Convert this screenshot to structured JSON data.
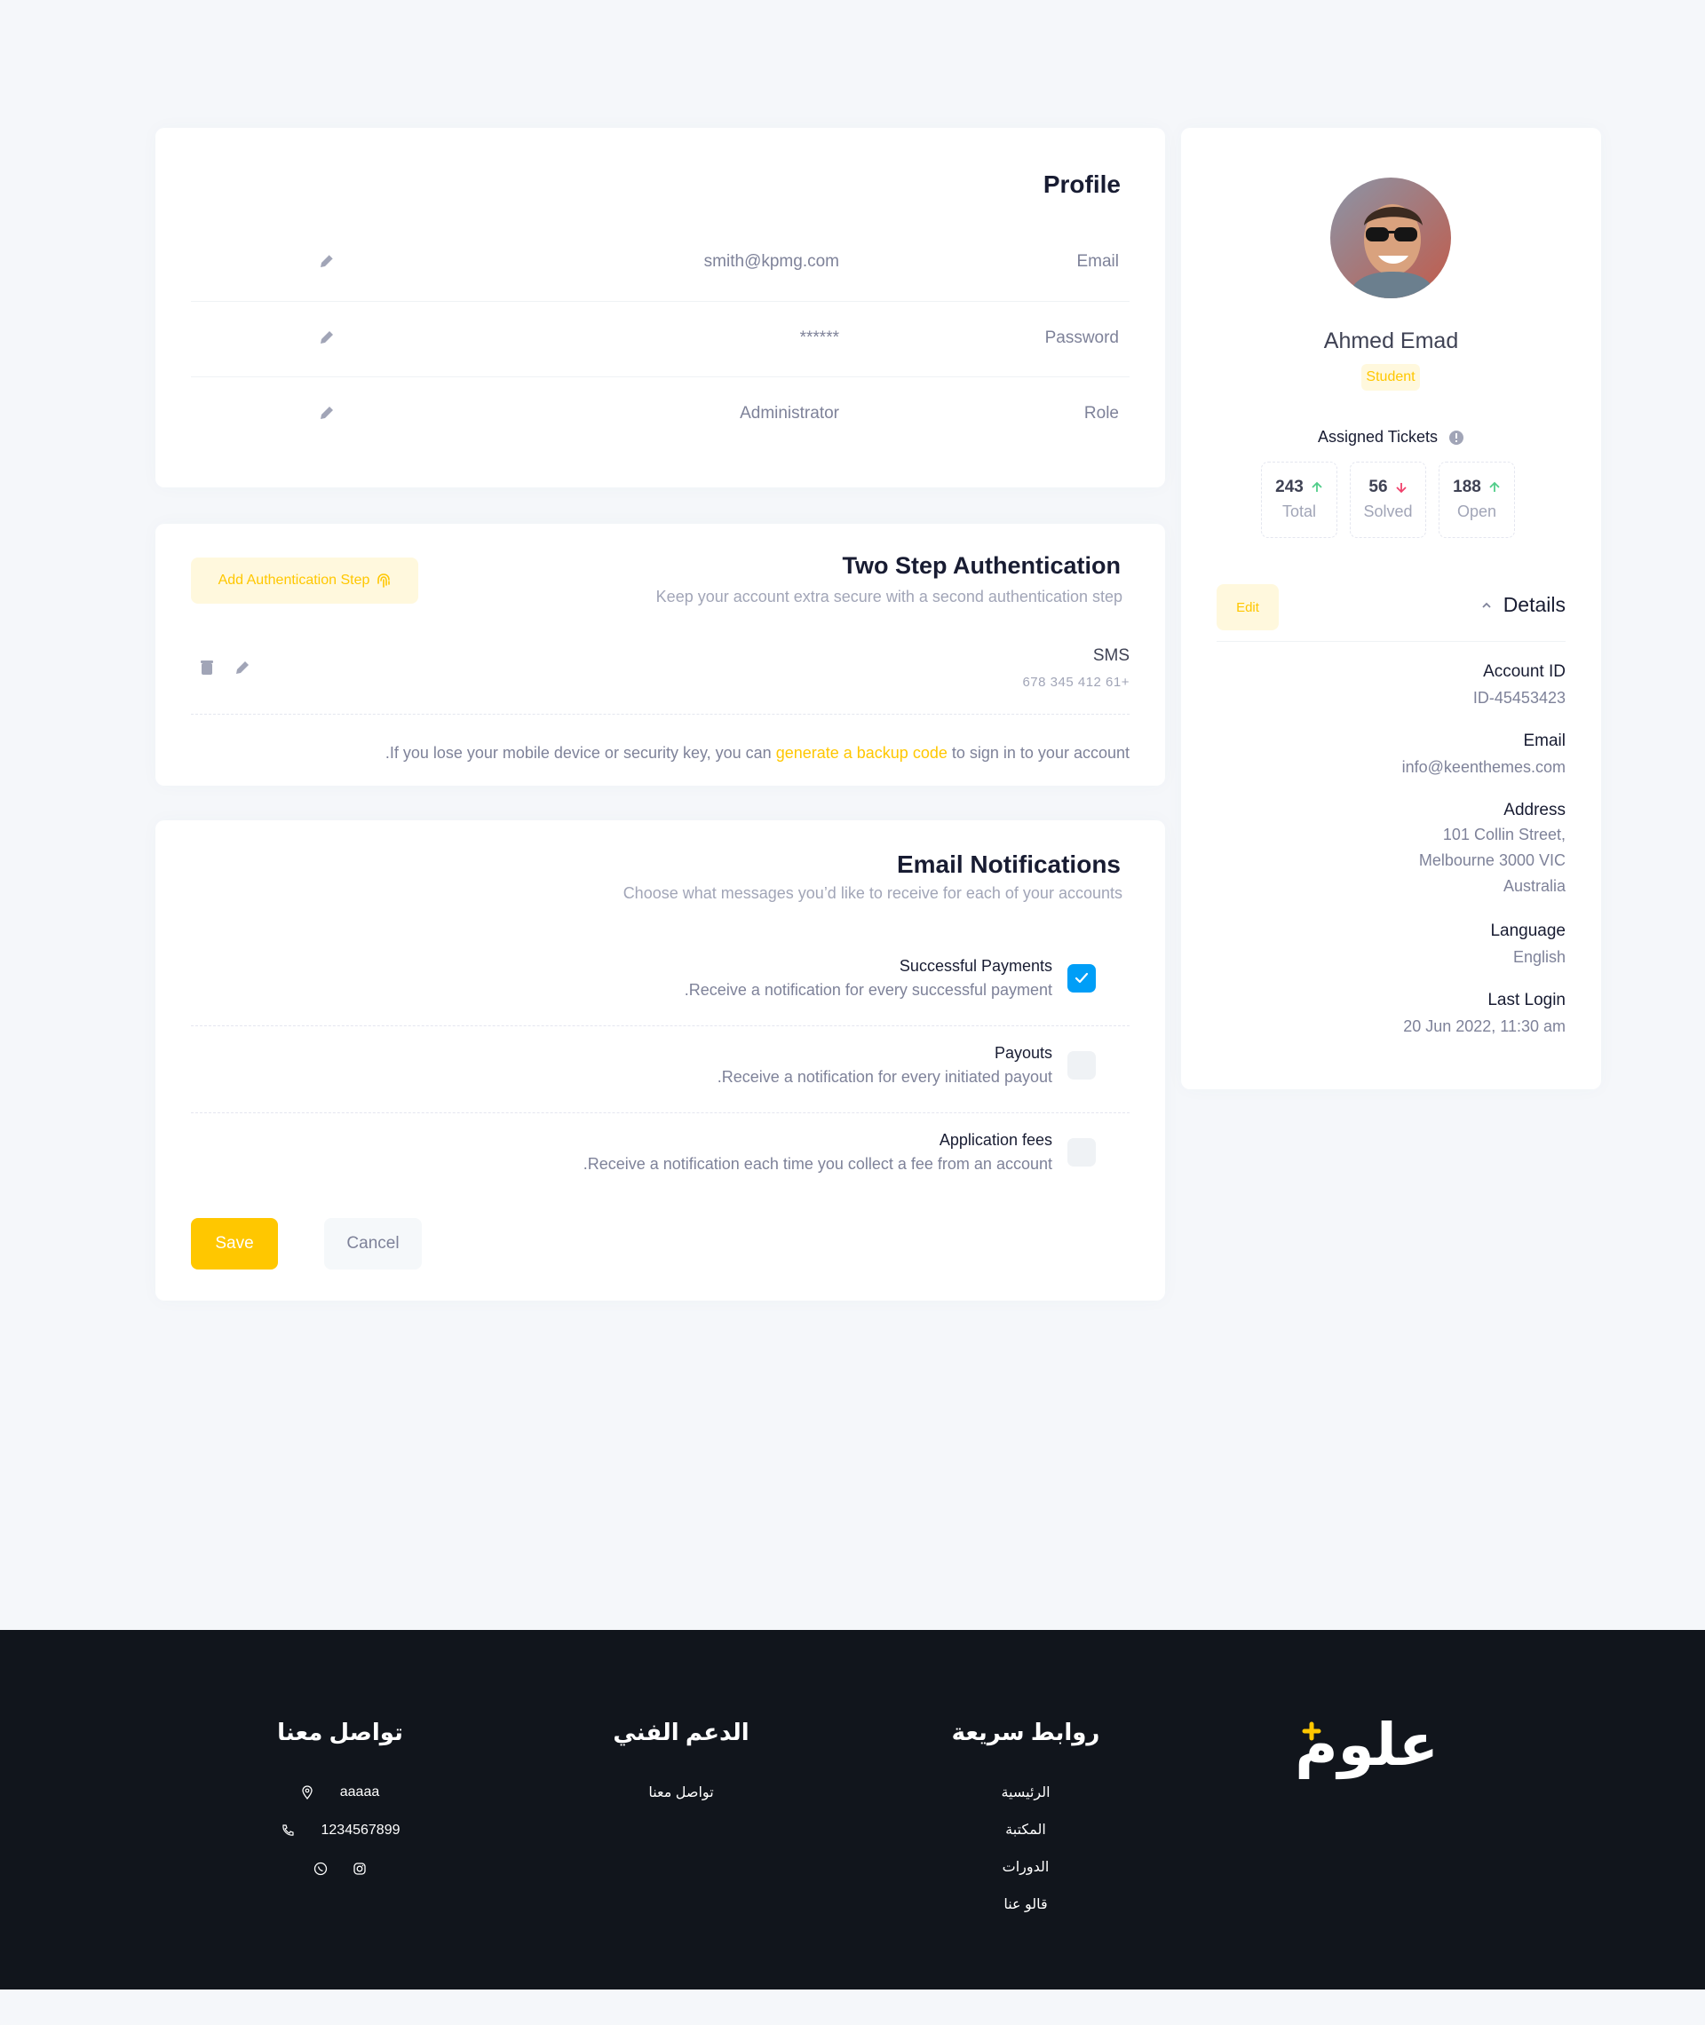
{
  "profile": {
    "title": "Profile",
    "rows": [
      {
        "label": "Email",
        "value": "smith@kpmg.com"
      },
      {
        "label": "Password",
        "value": "******"
      },
      {
        "label": "Role",
        "value": "Administrator"
      }
    ]
  },
  "two_step": {
    "title": "Two Step Authentication",
    "subtitle": "Keep your account extra secure with a second authentication step",
    "add_button": "Add Authentication Step",
    "method": {
      "title": "SMS",
      "phone": "678 345 412 61+"
    },
    "note_before": ".If you lose your mobile device or security key, you can",
    "note_link": "generate a backup code",
    "note_after": "to sign in to your account"
  },
  "notifications": {
    "title": "Email Notifications",
    "subtitle": "Choose what messages you’d like to receive for each of your accounts",
    "items": [
      {
        "title": "Successful Payments",
        "desc": ".Receive a notification for every successful payment",
        "checked": true
      },
      {
        "title": "Payouts",
        "desc": ".Receive a notification for every initiated payout",
        "checked": false
      },
      {
        "title": "Application fees",
        "desc": ".Receive a notification each time you collect a fee from an account",
        "checked": false
      }
    ],
    "save_label": "Save",
    "cancel_label": "Cancel"
  },
  "side": {
    "name": "Ahmed Emad",
    "role": "Student",
    "tickets_title": "Assigned Tickets",
    "stats": [
      {
        "value": "188",
        "label": "Open",
        "trend": "up"
      },
      {
        "value": "56",
        "label": "Solved",
        "trend": "down"
      },
      {
        "value": "243",
        "label": "Total",
        "trend": "up"
      }
    ],
    "edit_label": "Edit",
    "details_label": "Details",
    "details": [
      {
        "label": "Account ID",
        "value": "ID-45453423"
      },
      {
        "label": "Email",
        "value": "info@keenthemes.com"
      },
      {
        "label": "Address",
        "lines": [
          "101 Collin Street,",
          "Melbourne 3000 VIC",
          "Australia"
        ]
      },
      {
        "label": "Language",
        "value": "English"
      },
      {
        "label": "Last Login",
        "value": "20 Jun 2022, 11:30 am"
      }
    ]
  },
  "footer": {
    "logo_text": "علوم",
    "quick_links": {
      "title": "روابط سريعة",
      "items": [
        "الرئيسية",
        "المكتبة",
        "الدورات",
        "قالو عنا"
      ]
    },
    "support": {
      "title": "الدعم الفني",
      "items": [
        "تواصل معنا"
      ]
    },
    "contact": {
      "title": "تواصل معنا",
      "address": "aaaaa",
      "phone": "1234567899"
    }
  },
  "colors": {
    "accent": "#ffc700",
    "primary": "#009ef7",
    "footer_bg": "#11151c"
  }
}
